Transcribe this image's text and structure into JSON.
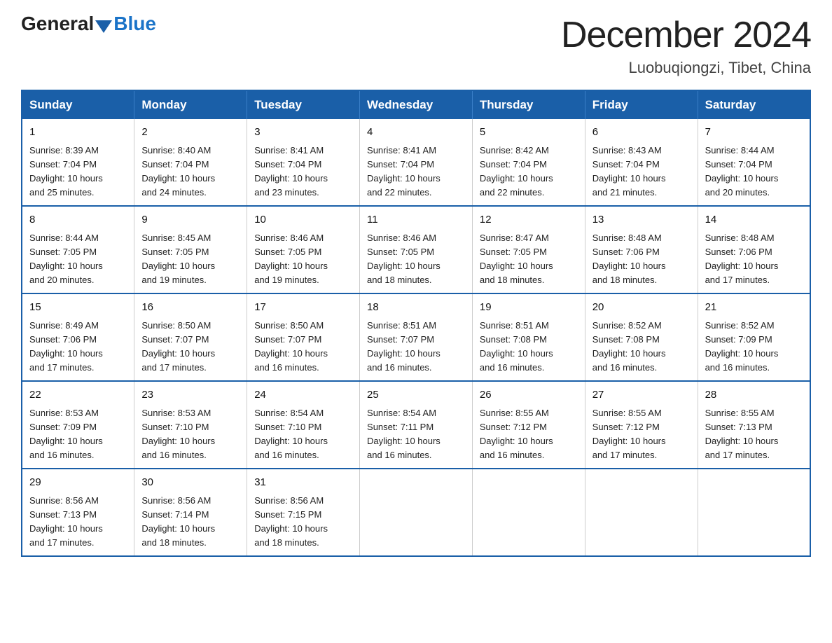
{
  "header": {
    "logo_general": "General",
    "logo_blue": "Blue",
    "month_year": "December 2024",
    "location": "Luobuqiongzi, Tibet, China"
  },
  "calendar": {
    "days_of_week": [
      "Sunday",
      "Monday",
      "Tuesday",
      "Wednesday",
      "Thursday",
      "Friday",
      "Saturday"
    ],
    "weeks": [
      [
        {
          "day": "1",
          "sunrise": "8:39 AM",
          "sunset": "7:04 PM",
          "daylight": "10 hours and 25 minutes."
        },
        {
          "day": "2",
          "sunrise": "8:40 AM",
          "sunset": "7:04 PM",
          "daylight": "10 hours and 24 minutes."
        },
        {
          "day": "3",
          "sunrise": "8:41 AM",
          "sunset": "7:04 PM",
          "daylight": "10 hours and 23 minutes."
        },
        {
          "day": "4",
          "sunrise": "8:41 AM",
          "sunset": "7:04 PM",
          "daylight": "10 hours and 22 minutes."
        },
        {
          "day": "5",
          "sunrise": "8:42 AM",
          "sunset": "7:04 PM",
          "daylight": "10 hours and 22 minutes."
        },
        {
          "day": "6",
          "sunrise": "8:43 AM",
          "sunset": "7:04 PM",
          "daylight": "10 hours and 21 minutes."
        },
        {
          "day": "7",
          "sunrise": "8:44 AM",
          "sunset": "7:04 PM",
          "daylight": "10 hours and 20 minutes."
        }
      ],
      [
        {
          "day": "8",
          "sunrise": "8:44 AM",
          "sunset": "7:05 PM",
          "daylight": "10 hours and 20 minutes."
        },
        {
          "day": "9",
          "sunrise": "8:45 AM",
          "sunset": "7:05 PM",
          "daylight": "10 hours and 19 minutes."
        },
        {
          "day": "10",
          "sunrise": "8:46 AM",
          "sunset": "7:05 PM",
          "daylight": "10 hours and 19 minutes."
        },
        {
          "day": "11",
          "sunrise": "8:46 AM",
          "sunset": "7:05 PM",
          "daylight": "10 hours and 18 minutes."
        },
        {
          "day": "12",
          "sunrise": "8:47 AM",
          "sunset": "7:05 PM",
          "daylight": "10 hours and 18 minutes."
        },
        {
          "day": "13",
          "sunrise": "8:48 AM",
          "sunset": "7:06 PM",
          "daylight": "10 hours and 18 minutes."
        },
        {
          "day": "14",
          "sunrise": "8:48 AM",
          "sunset": "7:06 PM",
          "daylight": "10 hours and 17 minutes."
        }
      ],
      [
        {
          "day": "15",
          "sunrise": "8:49 AM",
          "sunset": "7:06 PM",
          "daylight": "10 hours and 17 minutes."
        },
        {
          "day": "16",
          "sunrise": "8:50 AM",
          "sunset": "7:07 PM",
          "daylight": "10 hours and 17 minutes."
        },
        {
          "day": "17",
          "sunrise": "8:50 AM",
          "sunset": "7:07 PM",
          "daylight": "10 hours and 16 minutes."
        },
        {
          "day": "18",
          "sunrise": "8:51 AM",
          "sunset": "7:07 PM",
          "daylight": "10 hours and 16 minutes."
        },
        {
          "day": "19",
          "sunrise": "8:51 AM",
          "sunset": "7:08 PM",
          "daylight": "10 hours and 16 minutes."
        },
        {
          "day": "20",
          "sunrise": "8:52 AM",
          "sunset": "7:08 PM",
          "daylight": "10 hours and 16 minutes."
        },
        {
          "day": "21",
          "sunrise": "8:52 AM",
          "sunset": "7:09 PM",
          "daylight": "10 hours and 16 minutes."
        }
      ],
      [
        {
          "day": "22",
          "sunrise": "8:53 AM",
          "sunset": "7:09 PM",
          "daylight": "10 hours and 16 minutes."
        },
        {
          "day": "23",
          "sunrise": "8:53 AM",
          "sunset": "7:10 PM",
          "daylight": "10 hours and 16 minutes."
        },
        {
          "day": "24",
          "sunrise": "8:54 AM",
          "sunset": "7:10 PM",
          "daylight": "10 hours and 16 minutes."
        },
        {
          "day": "25",
          "sunrise": "8:54 AM",
          "sunset": "7:11 PM",
          "daylight": "10 hours and 16 minutes."
        },
        {
          "day": "26",
          "sunrise": "8:55 AM",
          "sunset": "7:12 PM",
          "daylight": "10 hours and 16 minutes."
        },
        {
          "day": "27",
          "sunrise": "8:55 AM",
          "sunset": "7:12 PM",
          "daylight": "10 hours and 17 minutes."
        },
        {
          "day": "28",
          "sunrise": "8:55 AM",
          "sunset": "7:13 PM",
          "daylight": "10 hours and 17 minutes."
        }
      ],
      [
        {
          "day": "29",
          "sunrise": "8:56 AM",
          "sunset": "7:13 PM",
          "daylight": "10 hours and 17 minutes."
        },
        {
          "day": "30",
          "sunrise": "8:56 AM",
          "sunset": "7:14 PM",
          "daylight": "10 hours and 18 minutes."
        },
        {
          "day": "31",
          "sunrise": "8:56 AM",
          "sunset": "7:15 PM",
          "daylight": "10 hours and 18 minutes."
        },
        null,
        null,
        null,
        null
      ]
    ],
    "sunrise_label": "Sunrise:",
    "sunset_label": "Sunset:",
    "daylight_label": "Daylight:"
  }
}
